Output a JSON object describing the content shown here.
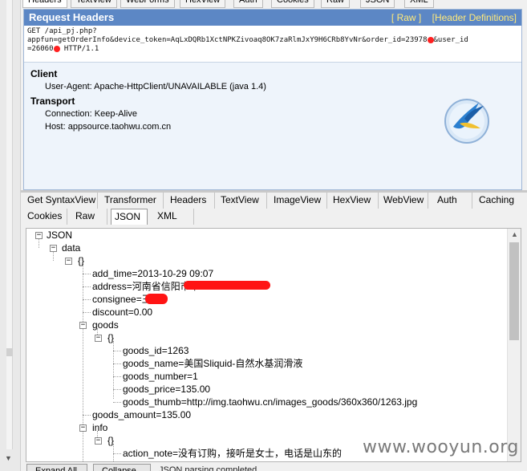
{
  "top_tabs": [
    "Headers",
    "TextView",
    "WebForms",
    "HexView",
    "Auth",
    "Cookies",
    "Raw",
    "JSON",
    "XML"
  ],
  "request": {
    "title": "Request Headers",
    "raw_link": "[ Raw ]",
    "defs_link": "[Header Definitions]",
    "line1": "GET /api_pj.php?",
    "line2a": "appfun=getOrderInfo&device_token=AqLxDQRb1XctNPKZivoaq8OK7zaRlmJxY9H6CRb8YvNr&order_id=23978",
    "line2b": "&user_id",
    "line3a": "=26060",
    "line3b": " HTTP/1.1",
    "groups": [
      {
        "name": "Client",
        "items": [
          "User-Agent: Apache-HttpClient/UNAVAILABLE (java 1.4)"
        ]
      },
      {
        "name": "Transport",
        "items": [
          "Connection: Keep-Alive",
          "Host: appsource.taohwu.com.cn"
        ]
      }
    ]
  },
  "response_tabs_row1": [
    "Get SyntaxView",
    "Transformer",
    "Headers",
    "TextView",
    "ImageView",
    "HexView",
    "WebView",
    "Auth",
    "Caching"
  ],
  "response_tabs_row2": [
    "Cookies",
    "Raw",
    "JSON",
    "XML"
  ],
  "active_response_tab": "JSON",
  "tree": {
    "root": "JSON",
    "data": "data",
    "obj": "{}",
    "add_time": "add_time=2013-10-29 09:07",
    "address": "address=河南省信阳市平",
    "consignee": "consignee=王",
    "discount": "discount=0.00",
    "goods": "goods",
    "goods_obj": "{}",
    "goods_id": "goods_id=1263",
    "goods_name": "goods_name=美国Sliquid-自然水基润滑液",
    "goods_number": "goods_number=1",
    "goods_price": "goods_price=135.00",
    "goods_thumb": "goods_thumb=http://img.taohwu.cn/images_goods/360x360/1263.jpg",
    "goods_amount": "goods_amount=135.00",
    "info": "info",
    "info_obj": "{}",
    "action_note": "action_note=没有订购，接听是女士，电话是山东的"
  },
  "buttons": {
    "expand": "Expand All",
    "collapse": "Collapse"
  },
  "status": "JSON parsing completed.",
  "watermark": "www.wooyun.org"
}
